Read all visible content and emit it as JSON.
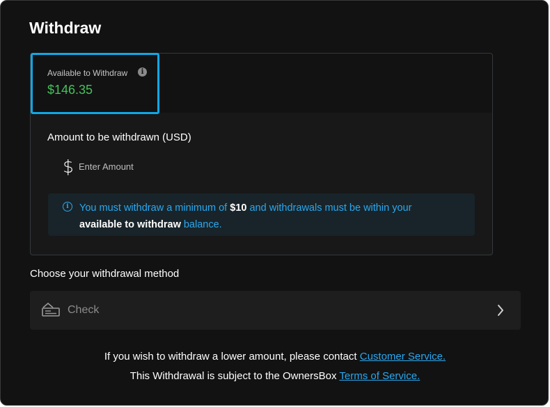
{
  "dialog": {
    "title": "Withdraw"
  },
  "balance": {
    "label": "Available to Withdraw",
    "value": "$146.35",
    "value_color": "#46c05c"
  },
  "amount": {
    "label": "Amount to be withdrawn (USD)",
    "currency_symbol": "$",
    "placeholder": "Enter Amount",
    "value": ""
  },
  "notice": {
    "part1": "You must withdraw a minimum of ",
    "min_amount": "$10",
    "part2": " and withdrawals must be within your ",
    "bold_phrase": "available to withdraw",
    "part3": " balance."
  },
  "method": {
    "heading": "Choose your withdrawal method",
    "options": [
      {
        "label": "Check",
        "icon": "check-payment-icon"
      }
    ]
  },
  "footer": {
    "line1_text": "If you wish to withdraw a lower amount, please contact ",
    "line1_link": "Customer Service.",
    "line2_text": "This Withdrawal is subject to the OwnersBox ",
    "line2_link": "Terms of Service."
  },
  "colors": {
    "accent": "#2aa8f0",
    "highlight_border": "#10a8e6",
    "background": "#121212"
  }
}
